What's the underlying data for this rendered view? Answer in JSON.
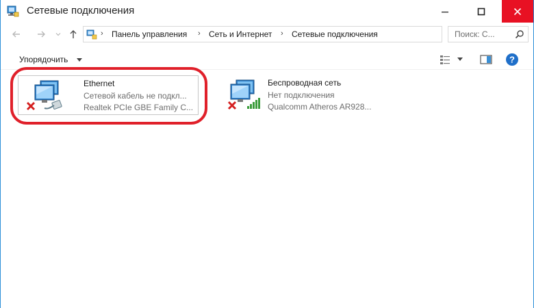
{
  "window": {
    "title": "Сетевые подключения"
  },
  "address": {
    "crumbs": [
      "Панель управления",
      "Сеть и Интернет",
      "Сетевые подключения"
    ]
  },
  "search": {
    "placeholder": "Поиск: С..."
  },
  "toolbar": {
    "organize_label": "Упорядочить"
  },
  "connections": [
    {
      "name": "Ethernet",
      "status": "Сетевой кабель не подкл...",
      "device": "Realtek PCIe GBE Family C..."
    },
    {
      "name": "Беспроводная сеть",
      "status": "Нет подключения",
      "device": "Qualcomm Atheros AR928..."
    }
  ],
  "colors": {
    "accent": "#1a8be0",
    "close": "#e81123",
    "highlight": "#e0202a",
    "error": "#d42020"
  }
}
